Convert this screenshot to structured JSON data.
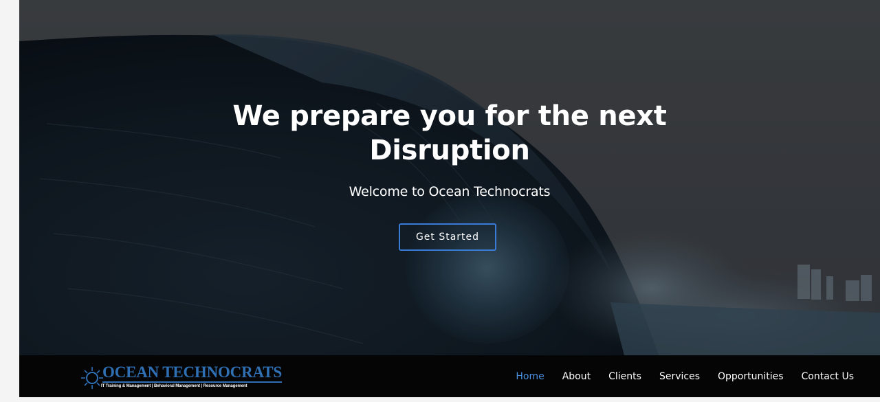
{
  "hero": {
    "title_line1": "We prepare you for the next",
    "title_line2": "Disruption",
    "subtitle": "Welcome to Ocean Technocrats",
    "cta_label": "Get Started"
  },
  "logo": {
    "name": "OCEAN TECHNOCRATS",
    "tagline": "IT Training & Management | Behavioral Management | Resource Management"
  },
  "nav": {
    "items": [
      {
        "label": "Home",
        "active": true
      },
      {
        "label": "About",
        "active": false
      },
      {
        "label": "Clients",
        "active": false
      },
      {
        "label": "Services",
        "active": false
      },
      {
        "label": "Opportunities",
        "active": false
      },
      {
        "label": "Contact Us",
        "active": false
      }
    ]
  },
  "colors": {
    "accent": "#4a8fe0",
    "button_border": "#3a7bd5",
    "logo_blue": "#2f6fb3",
    "navbar_bg": "#050505"
  }
}
